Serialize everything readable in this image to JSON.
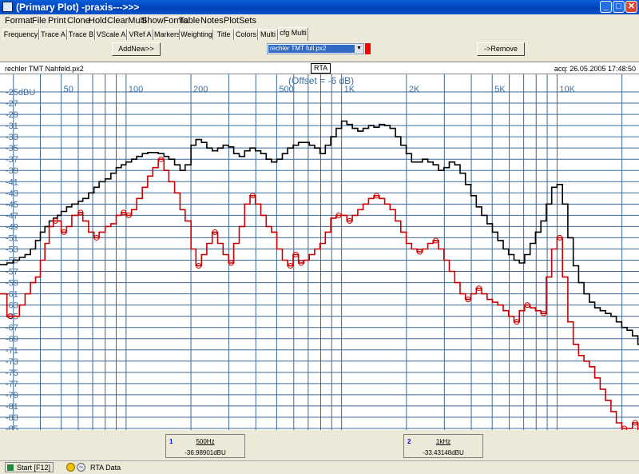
{
  "window": {
    "title": "(Primary Plot) -praxis--->>>"
  },
  "menu": [
    "Format",
    "File",
    "Print",
    "Clone",
    "Hold",
    "ClearMulti",
    "ShowForms",
    "Table",
    "Notes",
    "PlotSets"
  ],
  "tabs": [
    "Frequency",
    "Trace A",
    "Trace B",
    "VScale A",
    "VRef A",
    "Markers",
    "Weighting",
    "Title",
    "Colors",
    "Multi",
    "cfg Multi"
  ],
  "active_tab": "cfg Multi",
  "controls": {
    "add_label": "AddNew>>",
    "remove_label": "->Remove",
    "selected_file": "rechler TMT full.px2",
    "selected_color": "#ff0000"
  },
  "info": {
    "left": "rechler TMT Nahfeld.px2",
    "mode": "RTA",
    "acq": "acq: 26.05.2005 17:48:50"
  },
  "chart_data": {
    "type": "line",
    "title": "",
    "offset_label": "(Offset = -6 dB)",
    "x_scale": "log",
    "x_range": [
      26,
      24000
    ],
    "x_tick_labels": [
      {
        "value": 50,
        "label": "50"
      },
      {
        "value": 100,
        "label": "100"
      },
      {
        "value": 200,
        "label": "200"
      },
      {
        "value": 500,
        "label": "500"
      },
      {
        "value": 1000,
        "label": "1K"
      },
      {
        "value": 2000,
        "label": "2K"
      },
      {
        "value": 5000,
        "label": "5K"
      },
      {
        "value": 10000,
        "label": "10K"
      }
    ],
    "y_range": [
      -86,
      -24
    ],
    "y_ticks": [
      "-25dBU",
      "-27",
      "-29",
      "-31",
      "-33",
      "-35",
      "-37",
      "-39",
      "-41",
      "-43",
      "-45",
      "-47",
      "-49",
      "-51",
      "-53",
      "-55",
      "-57",
      "-59",
      "-61",
      "-63",
      "-65",
      "-67",
      "-69",
      "-71",
      "-73",
      "-75",
      "-77",
      "-79",
      "-81",
      "-83",
      "-85"
    ],
    "series": [
      {
        "color": "#000000",
        "points": [
          [
            26,
            -55.8
          ],
          [
            28,
            -55.5
          ],
          [
            30,
            -55
          ],
          [
            32,
            -54.5
          ],
          [
            34,
            -54
          ],
          [
            36,
            -53
          ],
          [
            38,
            -51.5
          ],
          [
            40,
            -50
          ],
          [
            42,
            -49
          ],
          [
            44,
            -48
          ],
          [
            46,
            -47.5
          ],
          [
            48,
            -47
          ],
          [
            50,
            -46.3
          ],
          [
            53,
            -45.5
          ],
          [
            56,
            -45
          ],
          [
            60,
            -44.5
          ],
          [
            63,
            -44
          ],
          [
            67,
            -43
          ],
          [
            71,
            -42
          ],
          [
            75,
            -41
          ],
          [
            80,
            -40.5
          ],
          [
            85,
            -39.5
          ],
          [
            90,
            -38.5
          ],
          [
            95,
            -38
          ],
          [
            100,
            -37.5
          ],
          [
            106,
            -37
          ],
          [
            112,
            -36.5
          ],
          [
            119,
            -36
          ],
          [
            126,
            -35.8
          ],
          [
            133,
            -35.8
          ],
          [
            141,
            -36
          ],
          [
            150,
            -36.5
          ],
          [
            158,
            -37
          ],
          [
            168,
            -38
          ],
          [
            178,
            -39
          ],
          [
            188,
            -38
          ],
          [
            200,
            -34.5
          ],
          [
            211,
            -33.5
          ],
          [
            224,
            -34
          ],
          [
            237,
            -35
          ],
          [
            251,
            -35.5
          ],
          [
            266,
            -35
          ],
          [
            282,
            -34.5
          ],
          [
            299,
            -34.8
          ],
          [
            316,
            -36
          ],
          [
            335,
            -36.5
          ],
          [
            355,
            -35.5
          ],
          [
            376,
            -35
          ],
          [
            398,
            -35.5
          ],
          [
            422,
            -36
          ],
          [
            447,
            -37
          ],
          [
            473,
            -37.5
          ],
          [
            501,
            -37
          ],
          [
            531,
            -36
          ],
          [
            562,
            -35
          ],
          [
            596,
            -34.5
          ],
          [
            631,
            -34
          ],
          [
            668,
            -34
          ],
          [
            708,
            -34.5
          ],
          [
            750,
            -35
          ],
          [
            794,
            -36
          ],
          [
            841,
            -34.5
          ],
          [
            891,
            -33
          ],
          [
            944,
            -31.5
          ],
          [
            1000,
            -30.2
          ],
          [
            1059,
            -30.8
          ],
          [
            1122,
            -31.5
          ],
          [
            1189,
            -32
          ],
          [
            1259,
            -31.5
          ],
          [
            1334,
            -31
          ],
          [
            1413,
            -31.3
          ],
          [
            1496,
            -30.8
          ],
          [
            1585,
            -31
          ],
          [
            1679,
            -31.5
          ],
          [
            1778,
            -33
          ],
          [
            1884,
            -34.5
          ],
          [
            1995,
            -36
          ],
          [
            2113,
            -37.5
          ],
          [
            2239,
            -37.5
          ],
          [
            2371,
            -37
          ],
          [
            2512,
            -37.5
          ],
          [
            2661,
            -38
          ],
          [
            2818,
            -39
          ],
          [
            2985,
            -38.5
          ],
          [
            3162,
            -37.5
          ],
          [
            3350,
            -38
          ],
          [
            3548,
            -39.5
          ],
          [
            3758,
            -41.5
          ],
          [
            3981,
            -43.5
          ],
          [
            4217,
            -45.5
          ],
          [
            4467,
            -47
          ],
          [
            4732,
            -48.5
          ],
          [
            5012,
            -50
          ],
          [
            5309,
            -51.5
          ],
          [
            5623,
            -53
          ],
          [
            5957,
            -54
          ],
          [
            6310,
            -55
          ],
          [
            6683,
            -55.5
          ],
          [
            7079,
            -54
          ],
          [
            7499,
            -52
          ],
          [
            7943,
            -50
          ],
          [
            8414,
            -48
          ],
          [
            8913,
            -45
          ],
          [
            9441,
            -42
          ],
          [
            10000,
            -41.5
          ],
          [
            10593,
            -45
          ],
          [
            11220,
            -51
          ],
          [
            11885,
            -56
          ],
          [
            12589,
            -59
          ],
          [
            13335,
            -61
          ],
          [
            14125,
            -62.5
          ],
          [
            14962,
            -63.5
          ],
          [
            15849,
            -64
          ],
          [
            16788,
            -64.5
          ],
          [
            17783,
            -65
          ],
          [
            18836,
            -66
          ],
          [
            19953,
            -67
          ],
          [
            21135,
            -67.5
          ],
          [
            22387,
            -68.5
          ],
          [
            23714,
            -70
          ]
        ]
      },
      {
        "color": "#cc0000",
        "points": [
          [
            26,
            -61
          ],
          [
            28,
            -65
          ],
          [
            30,
            -65
          ],
          [
            32,
            -63
          ],
          [
            34,
            -61
          ],
          [
            36,
            -59
          ],
          [
            38,
            -58
          ],
          [
            40,
            -55
          ],
          [
            42,
            -52
          ],
          [
            44,
            -49
          ],
          [
            46,
            -48
          ],
          [
            48,
            -48
          ],
          [
            50,
            -50
          ],
          [
            53,
            -49
          ],
          [
            56,
            -47
          ],
          [
            60,
            -46.5
          ],
          [
            63,
            -48
          ],
          [
            67,
            -50
          ],
          [
            71,
            -51
          ],
          [
            75,
            -50
          ],
          [
            80,
            -49
          ],
          [
            85,
            -48.5
          ],
          [
            90,
            -47
          ],
          [
            95,
            -46.5
          ],
          [
            100,
            -47
          ],
          [
            106,
            -46
          ],
          [
            112,
            -44
          ],
          [
            119,
            -42
          ],
          [
            126,
            -40
          ],
          [
            133,
            -38.5
          ],
          [
            141,
            -37
          ],
          [
            150,
            -39
          ],
          [
            158,
            -41
          ],
          [
            168,
            -43
          ],
          [
            178,
            -46
          ],
          [
            188,
            -48
          ],
          [
            200,
            -53
          ],
          [
            211,
            -56
          ],
          [
            224,
            -54
          ],
          [
            237,
            -52
          ],
          [
            251,
            -50
          ],
          [
            266,
            -52
          ],
          [
            282,
            -54
          ],
          [
            299,
            -55.5
          ],
          [
            316,
            -52
          ],
          [
            335,
            -49
          ],
          [
            355,
            -45
          ],
          [
            376,
            -43.5
          ],
          [
            398,
            -45
          ],
          [
            422,
            -47
          ],
          [
            447,
            -49
          ],
          [
            473,
            -50
          ],
          [
            501,
            -53
          ],
          [
            531,
            -55
          ],
          [
            562,
            -56
          ],
          [
            596,
            -54
          ],
          [
            631,
            -55.5
          ],
          [
            668,
            -55
          ],
          [
            708,
            -54
          ],
          [
            750,
            -53
          ],
          [
            794,
            -52
          ],
          [
            841,
            -50
          ],
          [
            891,
            -47.5
          ],
          [
            944,
            -47
          ],
          [
            1000,
            -47
          ],
          [
            1059,
            -48
          ],
          [
            1122,
            -47
          ],
          [
            1189,
            -46
          ],
          [
            1259,
            -45
          ],
          [
            1334,
            -44
          ],
          [
            1413,
            -43.5
          ],
          [
            1496,
            -44
          ],
          [
            1585,
            -45
          ],
          [
            1679,
            -46
          ],
          [
            1778,
            -48
          ],
          [
            1884,
            -50
          ],
          [
            1995,
            -52
          ],
          [
            2113,
            -53
          ],
          [
            2239,
            -53.5
          ],
          [
            2371,
            -53
          ],
          [
            2512,
            -52
          ],
          [
            2661,
            -51.5
          ],
          [
            2818,
            -53
          ],
          [
            2985,
            -55
          ],
          [
            3162,
            -57
          ],
          [
            3350,
            -59
          ],
          [
            3548,
            -61
          ],
          [
            3758,
            -62
          ],
          [
            3981,
            -61
          ],
          [
            4217,
            -60
          ],
          [
            4467,
            -61
          ],
          [
            4732,
            -62
          ],
          [
            5012,
            -62.5
          ],
          [
            5309,
            -63
          ],
          [
            5623,
            -64
          ],
          [
            5957,
            -65
          ],
          [
            6310,
            -66
          ],
          [
            6683,
            -64
          ],
          [
            7079,
            -63
          ],
          [
            7499,
            -63.5
          ],
          [
            7943,
            -64
          ],
          [
            8414,
            -64.5
          ],
          [
            8913,
            -58
          ],
          [
            9441,
            -53
          ],
          [
            10000,
            -51
          ],
          [
            10593,
            -58
          ],
          [
            11220,
            -66
          ],
          [
            11885,
            -70
          ],
          [
            12589,
            -72
          ],
          [
            13335,
            -73
          ],
          [
            14125,
            -74
          ],
          [
            14962,
            -76
          ],
          [
            15849,
            -78
          ],
          [
            16788,
            -80
          ],
          [
            17783,
            -82
          ],
          [
            18836,
            -84
          ],
          [
            19953,
            -85
          ],
          [
            21135,
            -85
          ],
          [
            22387,
            -84
          ],
          [
            23714,
            -86
          ]
        ]
      }
    ]
  },
  "markers": [
    {
      "num": "1",
      "freq": "500Hz",
      "value": "-36.98901dBU"
    },
    {
      "num": "2",
      "freq": "1kHz",
      "value": "-33.43148dBU"
    }
  ],
  "taskbar": {
    "start": "Start [F12]",
    "rta": "RTA Data"
  }
}
